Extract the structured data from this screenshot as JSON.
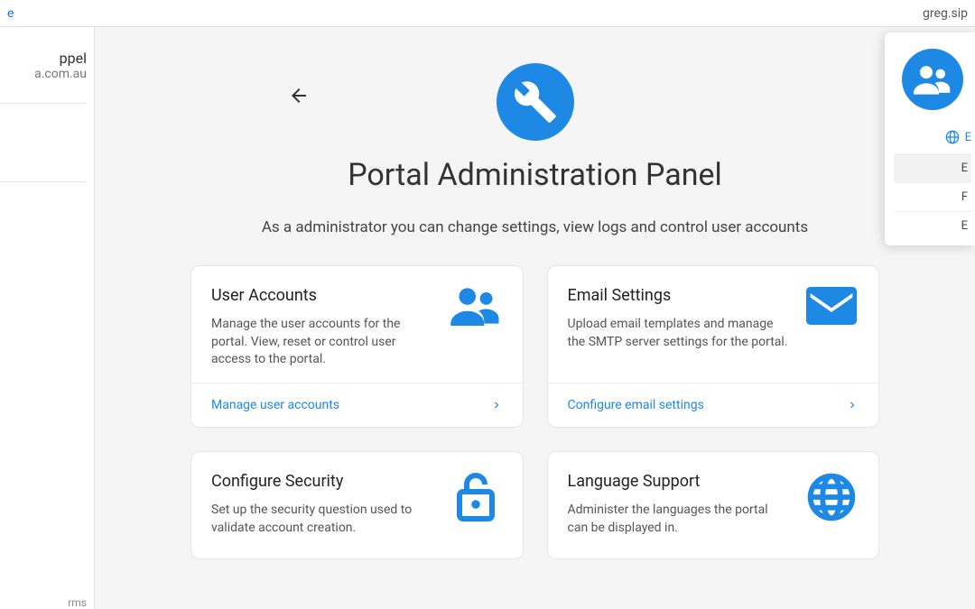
{
  "topbar": {
    "left_fragment": "e",
    "right_fragment": "greg.sip"
  },
  "sidebar": {
    "name_fragment": "ppel",
    "domain_fragment": "a.com.au",
    "footer_fragment": "rms"
  },
  "page": {
    "title": "Portal Administration Panel",
    "subtitle": "As a administrator you can change settings, view logs and control user accounts"
  },
  "cards": [
    {
      "title": "User Accounts",
      "desc": "Manage the user accounts for the portal. View, reset or control user access to the portal.",
      "action": "Manage user accounts",
      "icon": "people"
    },
    {
      "title": "Email Settings",
      "desc": "Upload email templates and manage the SMTP server settings for the portal.",
      "action": "Configure email settings",
      "icon": "mail"
    },
    {
      "title": "Configure Security",
      "desc": "Set up the security question used to validate account creation.",
      "action": "",
      "icon": "lock-open"
    },
    {
      "title": "Language Support",
      "desc": "Administer the languages the portal can be displayed in.",
      "action": "",
      "icon": "globe"
    }
  ],
  "user_popup": {
    "lang_letter": "E",
    "menu": [
      "E",
      "F",
      "E"
    ]
  }
}
